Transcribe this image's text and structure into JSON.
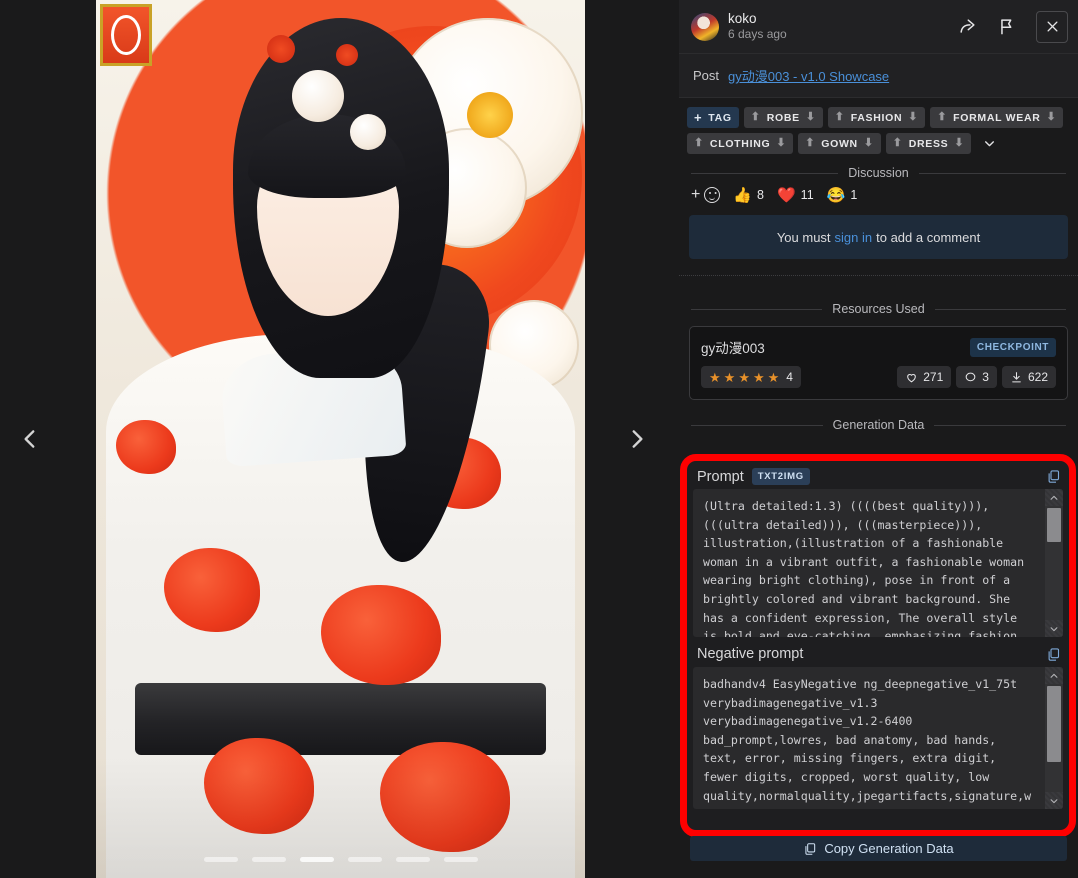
{
  "viewer": {
    "nav_prev_icon": "chevron-left-icon",
    "nav_next_icon": "chevron-right-icon",
    "pagination_count": 6,
    "pagination_active_index": 2
  },
  "header": {
    "username": "koko",
    "timestamp": "6 days ago",
    "share_icon": "share-icon",
    "report_icon": "flag-icon",
    "close_icon": "close-icon"
  },
  "post": {
    "label": "Post",
    "link": "gy动漫003 - v1.0 Showcase"
  },
  "tags": {
    "add_label": "TAG",
    "items": [
      {
        "label": "ROBE"
      },
      {
        "label": "FASHION"
      },
      {
        "label": "FORMAL WEAR"
      },
      {
        "label": "CLOTHING"
      },
      {
        "label": "GOWN"
      },
      {
        "label": "DRESS"
      }
    ],
    "more_icon": "chevron-down-icon"
  },
  "discussion": {
    "divider_label": "Discussion",
    "reactions": [
      {
        "icon": "thumbs-up-emoji",
        "glyph": "👍",
        "count": "8"
      },
      {
        "icon": "heart-emoji",
        "glyph": "❤️",
        "count": "11"
      },
      {
        "icon": "laughing-emoji",
        "glyph": "😂",
        "count": "1"
      }
    ],
    "signin_prefix": "You must",
    "signin_link": "sign in",
    "signin_suffix": "to add a comment"
  },
  "resources": {
    "divider_label": "Resources Used",
    "items": [
      {
        "name": "gy动漫003",
        "badge": "CHECKPOINT",
        "rating_stars": 5,
        "rating_count": "4",
        "likes": "271",
        "comments": "3",
        "downloads": "622"
      }
    ]
  },
  "generation": {
    "divider_label": "Generation Data",
    "prompt_title": "Prompt",
    "prompt_chip": "TXT2IMG",
    "prompt_text": "(Ultra detailed:1.3) ((((best quality))), (((ultra detailed))), (((masterpiece))), illustration,(illustration of a fashionable woman in a vibrant outfit, a fashionable woman wearing bright clothing), pose in front of a brightly colored and vibrant background. She has a confident expression, The overall style is bold and eye-catching, emphasizing fashion",
    "negative_title": "Negative prompt",
    "negative_text": "badhandv4 EasyNegative ng_deepnegative_v1_75t verybadimagenegative_v1.3 verybadimagenegative_v1.2-6400 bad_prompt,lowres, bad anatomy, bad hands, text, error, missing fingers, extra digit, fewer digits, cropped, worst quality, low quality,normalquality,jpegartifacts,signature,watermark,username,blurry,watermark,signature,wa",
    "copy_icon": "copy-icon",
    "copy_button_label": "Copy Generation Data",
    "highlight_color": "#ff0000"
  }
}
